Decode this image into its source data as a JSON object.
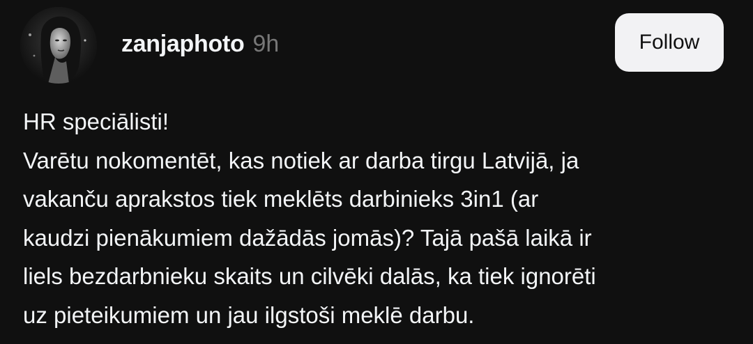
{
  "post": {
    "author": {
      "username": "zanjaphoto",
      "avatar_icon": "profile-photo-avatar"
    },
    "timestamp": "9h",
    "follow_button_label": "Follow",
    "text_lines": [
      "HR speciālisti!",
      "Varētu nokomentēt, kas notiek ar darba tirgu Latvijā, ja",
      "vakanču aprakstos tiek meklēts darbinieks 3in1 (ar",
      "kaudzi pienākumiem dažādās jomās)? Tajā pašā laikā ir",
      "liels bezdarbnieku skaits un cilvēki dalās, ka tiek ignorēti",
      "uz pieteikumiem un jau ilgstoši meklē darbu."
    ]
  },
  "colors": {
    "background": "#101010",
    "text_primary": "#f3f5f7",
    "text_secondary": "#777777",
    "button_background": "#f2f2f4",
    "button_text": "#101010"
  }
}
